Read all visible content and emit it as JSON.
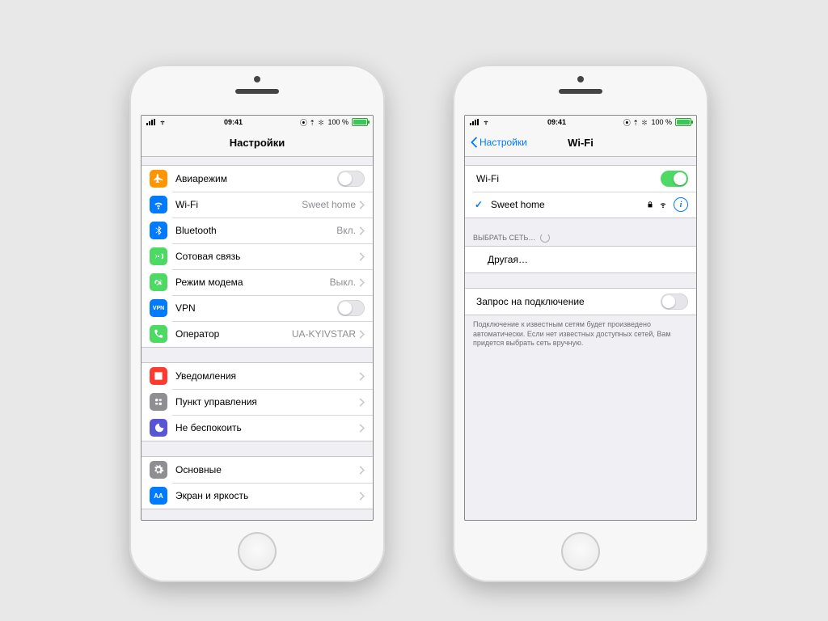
{
  "statusbar": {
    "time": "09:41",
    "battery_text": "100 %"
  },
  "left_screen": {
    "title": "Настройки",
    "group1": [
      {
        "key": "airplane",
        "label": "Авиарежим",
        "value": "",
        "kind": "switch",
        "on": false,
        "color": "#ff9501"
      },
      {
        "key": "wifi",
        "label": "Wi-Fi",
        "value": "Sweet home",
        "kind": "link",
        "color": "#007aff"
      },
      {
        "key": "bluetooth",
        "label": "Bluetooth",
        "value": "Вкл.",
        "kind": "link",
        "color": "#007aff"
      },
      {
        "key": "cellular",
        "label": "Сотовая связь",
        "value": "",
        "kind": "link",
        "color": "#4cd964"
      },
      {
        "key": "hotspot",
        "label": "Режим модема",
        "value": "Выкл.",
        "kind": "link",
        "color": "#4cd964"
      },
      {
        "key": "vpn",
        "label": "VPN",
        "value": "",
        "kind": "switch",
        "on": false,
        "color": "#007aff",
        "text_icon": "VPN"
      },
      {
        "key": "carrier",
        "label": "Оператор",
        "value": "UA-KYIVSTAR",
        "kind": "link",
        "color": "#4cd964"
      }
    ],
    "group2": [
      {
        "key": "notifications",
        "label": "Уведомления",
        "color": "#ff3b30"
      },
      {
        "key": "controlcenter",
        "label": "Пункт управления",
        "color": "#8e8e93"
      },
      {
        "key": "dnd",
        "label": "Не беспокоить",
        "color": "#5856d6"
      }
    ],
    "group3": [
      {
        "key": "general",
        "label": "Основные",
        "color": "#8e8e93"
      },
      {
        "key": "display",
        "label": "Экран и яркость",
        "color": "#007aff",
        "text_icon": "AA"
      }
    ]
  },
  "right_screen": {
    "back_label": "Настройки",
    "title": "Wi-Fi",
    "wifi_row_label": "Wi-Fi",
    "wifi_on": true,
    "connected_network": "Sweet home",
    "choose_network_header": "ВЫБРАТЬ СЕТЬ…",
    "other_label": "Другая…",
    "ask_to_join_label": "Запрос на подключение",
    "ask_to_join_on": false,
    "footer": "Подключение к известным сетям будет произведено автоматически. Если нет известных доступных сетей, Вам придется выбрать сеть вручную."
  }
}
